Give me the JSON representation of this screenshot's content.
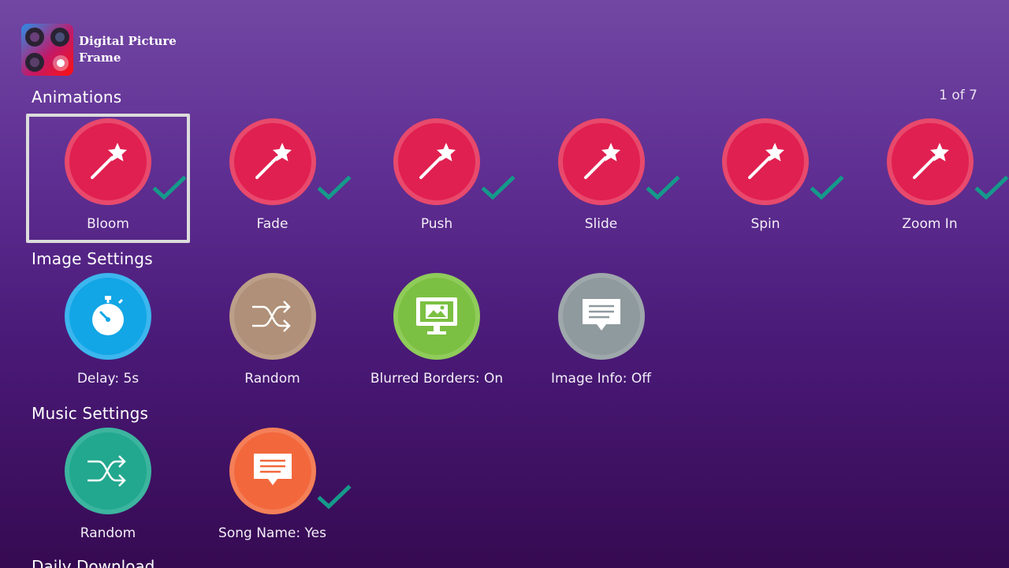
{
  "app": {
    "title": "Digital Picture Frame",
    "icon": "camera-lens-collage-icon"
  },
  "colors": {
    "animation_red": "#e02050",
    "animation_ring": "#e8496c",
    "delay_blue": "#12a6e6",
    "random_tan": "#b09078",
    "blur_green": "#7cc043",
    "info_grey": "#8f9a9e",
    "music_teal": "#22a88f",
    "song_orange": "#f2683c",
    "check_teal": "#159a8a"
  },
  "animations": {
    "title": "Animations",
    "pager": "1 of 7",
    "items": [
      {
        "label": "Bloom",
        "icon": "magic-wand-icon",
        "selected": true,
        "focused": true
      },
      {
        "label": "Fade",
        "icon": "magic-wand-icon",
        "selected": true
      },
      {
        "label": "Push",
        "icon": "magic-wand-icon",
        "selected": true
      },
      {
        "label": "Slide",
        "icon": "magic-wand-icon",
        "selected": true
      },
      {
        "label": "Spin",
        "icon": "magic-wand-icon",
        "selected": true
      },
      {
        "label": "Zoom In",
        "icon": "magic-wand-icon",
        "selected": true
      }
    ]
  },
  "image_settings": {
    "title": "Image Settings",
    "items": [
      {
        "label": "Delay: 5s",
        "icon": "stopwatch-icon"
      },
      {
        "label": "Random",
        "icon": "shuffle-icon"
      },
      {
        "label": "Blurred Borders: On",
        "icon": "monitor-picture-icon"
      },
      {
        "label": "Image Info: Off",
        "icon": "message-icon"
      }
    ]
  },
  "music_settings": {
    "title": "Music Settings",
    "items": [
      {
        "label": "Random",
        "icon": "shuffle-icon"
      },
      {
        "label": "Song Name: Yes",
        "icon": "message-icon",
        "selected": true
      }
    ]
  },
  "daily_download": {
    "title": "Daily Download"
  }
}
